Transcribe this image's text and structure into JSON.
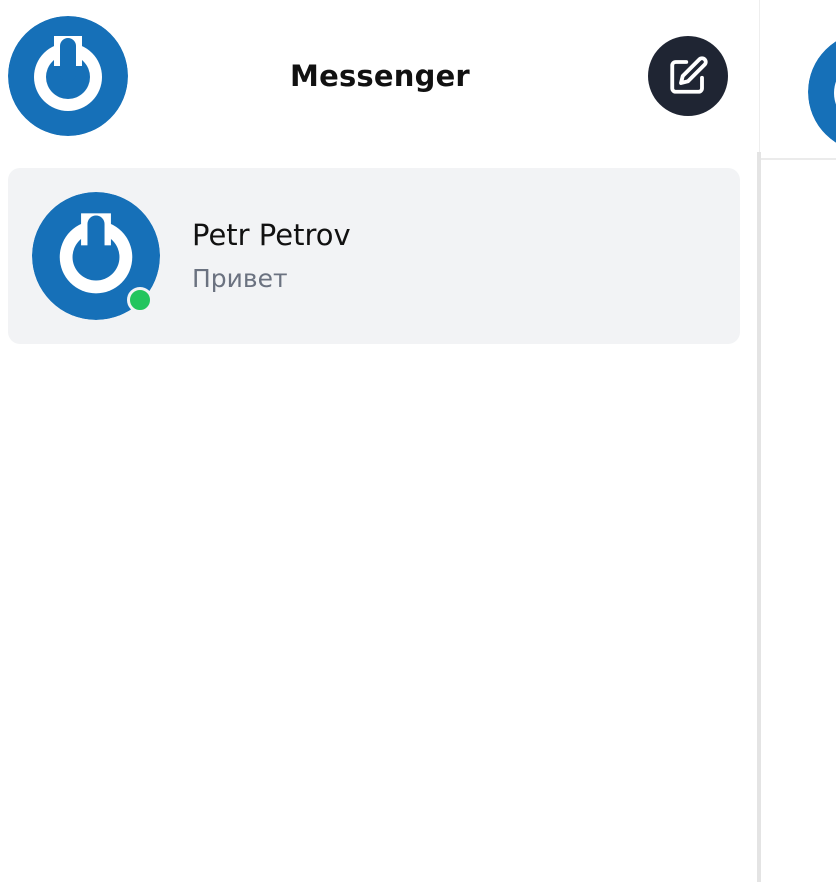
{
  "header": {
    "title": "Messenger",
    "avatar_icon": "power-logo-avatar",
    "compose_icon": "edit-square-icon"
  },
  "conversations": [
    {
      "name": "Petr Petrov",
      "last_message": "Привет",
      "status": "online",
      "avatar_icon": "power-logo-avatar"
    }
  ],
  "colors": {
    "avatar_blue": "#1670b8",
    "compose_bg": "#1f2533",
    "online": "#22c55e",
    "item_bg": "#f2f3f5",
    "muted_text": "#6b7280"
  }
}
